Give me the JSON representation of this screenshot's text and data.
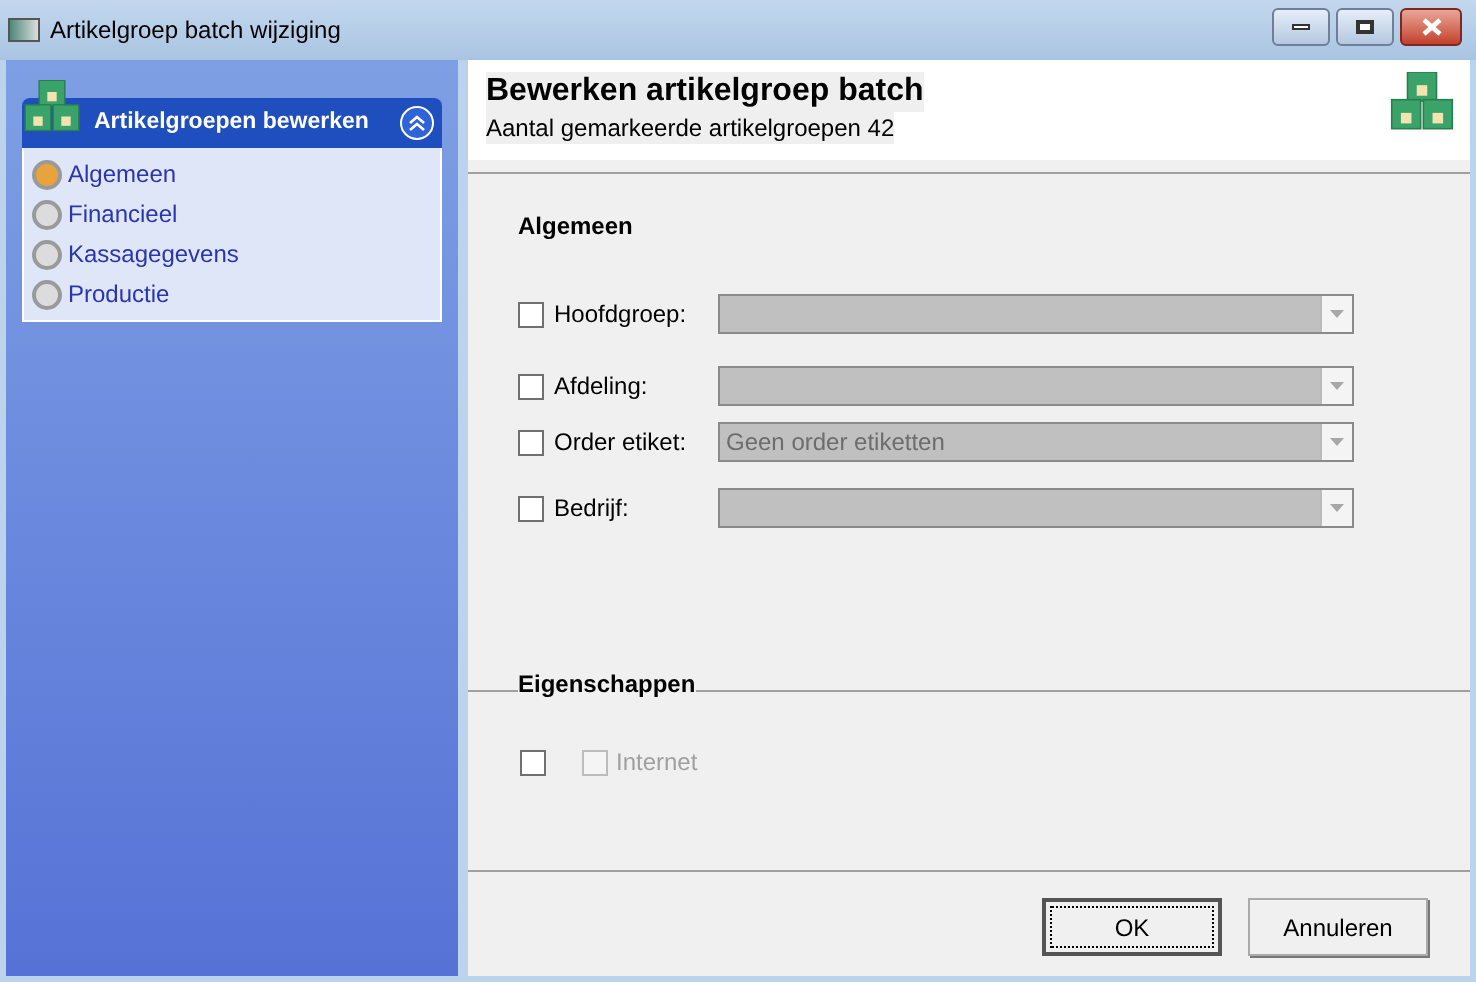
{
  "window": {
    "title": "Artikelgroep batch wijziging"
  },
  "sidebar": {
    "title": "Artikelgroepen bewerken",
    "expanded": true,
    "items": [
      {
        "label": "Algemeen",
        "selected": true
      },
      {
        "label": "Financieel",
        "selected": false
      },
      {
        "label": "Kassagegevens",
        "selected": false
      },
      {
        "label": "Productie",
        "selected": false
      }
    ]
  },
  "header": {
    "title": "Bewerken artikelgroep batch",
    "subtitle": "Aantal gemarkeerde artikelgroepen 42"
  },
  "general": {
    "heading": "Algemeen",
    "rows": [
      {
        "label": "Hoofdgroep:",
        "checked": false
      },
      {
        "label": "Afdeling:",
        "checked": false
      },
      {
        "label": "Order etiket:",
        "checked": false,
        "value": "Geen order etiketten"
      },
      {
        "label": "Bedrijf:",
        "checked": false
      }
    ]
  },
  "properties": {
    "heading": "Eigenschappen",
    "checks": [
      {
        "checked": false,
        "disabled": false
      },
      {
        "label": "Internet",
        "checked": false,
        "disabled": true
      }
    ]
  },
  "buttons": [
    {
      "label": "OK",
      "default": true
    },
    {
      "label": "Annuleren",
      "default": false
    }
  ]
}
